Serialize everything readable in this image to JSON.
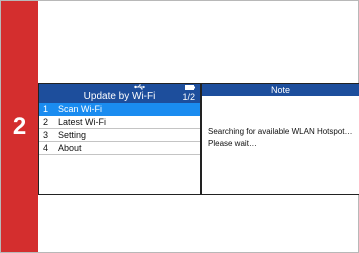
{
  "step": {
    "number": "2",
    "color": "#d42e2e"
  },
  "device_menu": {
    "status_icons": [
      "usb-icon",
      "battery-icon"
    ],
    "title": "Update by Wi-Fi",
    "page": "1/2",
    "header_color": "#1d4e9c",
    "selected_color": "#1a8cf0",
    "items": [
      {
        "num": "1",
        "label": "Scan Wi-Fi",
        "selected": true
      },
      {
        "num": "2",
        "label": "Latest Wi-Fi",
        "selected": false
      },
      {
        "num": "3",
        "label": "Setting",
        "selected": false
      },
      {
        "num": "4",
        "label": "About",
        "selected": false
      }
    ]
  },
  "note_dialog": {
    "title": "Note",
    "line1": "Searching for available WLAN Hotspot…",
    "line2": "Please wait…"
  }
}
